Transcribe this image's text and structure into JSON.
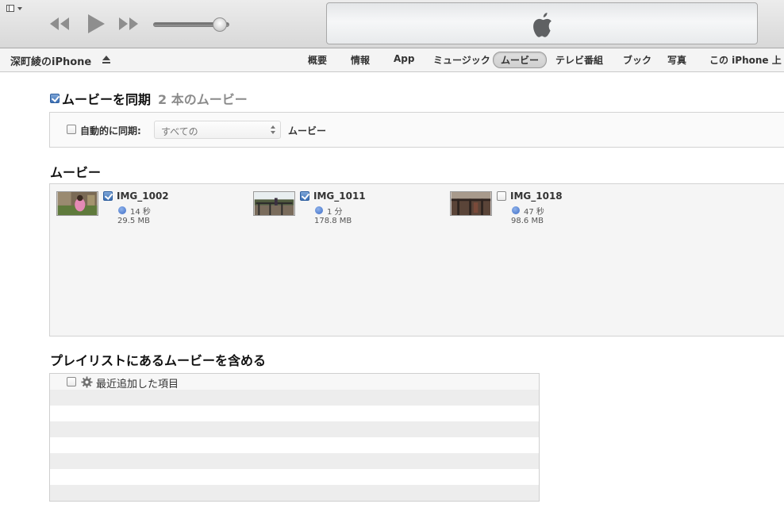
{
  "toolbar": {
    "menu_icon": "window-menu-icon",
    "rewind_icon": "rewind-icon",
    "play_icon": "play-icon",
    "forward_icon": "fast-forward-icon",
    "volume_level": 0.87,
    "lcd_icon": "apple-logo-icon"
  },
  "device": {
    "name": "深町綾のiPhone",
    "eject_icon": "eject-icon"
  },
  "tabs": [
    {
      "label": "概要",
      "selected": false
    },
    {
      "label": "情報",
      "selected": false
    },
    {
      "label": "App",
      "selected": false
    },
    {
      "label": "ミュージック",
      "selected": false
    },
    {
      "label": "ムービー",
      "selected": true
    },
    {
      "label": "テレビ番組",
      "selected": false
    },
    {
      "label": "ブック",
      "selected": false
    },
    {
      "label": "写真",
      "selected": false
    },
    {
      "label": "この iPhone 上",
      "selected": false
    }
  ],
  "sync": {
    "checked": true,
    "label": "ムービーを同期",
    "count": "2 本のムービー"
  },
  "auto_sync": {
    "checked": false,
    "label": "自動的に同期:",
    "select_value": "すべての",
    "suffix": "ムービー"
  },
  "movies_heading": "ムービー",
  "movies": [
    {
      "title": "IMG_1002",
      "checked": true,
      "duration": "14 秒",
      "size": "29.5 MB"
    },
    {
      "title": "IMG_1011",
      "checked": true,
      "duration": "1 分",
      "size": "178.8 MB"
    },
    {
      "title": "IMG_1018",
      "checked": false,
      "duration": "47 秒",
      "size": "98.6 MB"
    }
  ],
  "playlists_heading": "プレイリストにあるムービーを含める",
  "playlists": [
    {
      "label": "最近追加した項目",
      "checked": false,
      "icon": "gear-icon"
    }
  ],
  "colors": {
    "accent_blue": "#3b6fb4",
    "toolbar_bg": "#dcdcdc",
    "muted_text": "#8b8b8b"
  }
}
